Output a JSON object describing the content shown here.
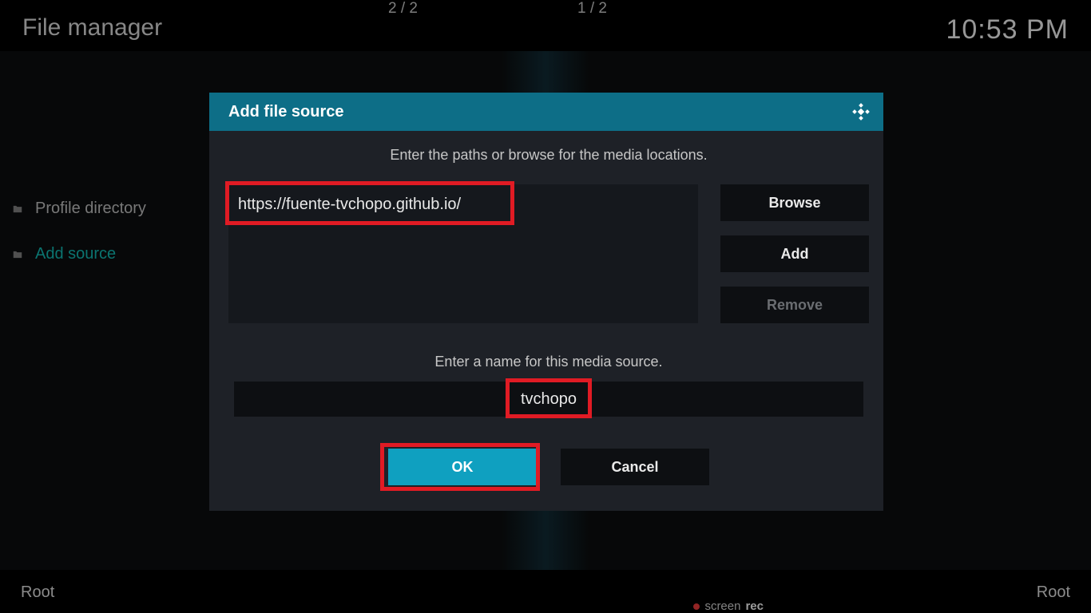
{
  "header": {
    "title": "File manager",
    "time": "10:53 PM"
  },
  "sidebar": {
    "items": [
      {
        "label": "Profile directory",
        "active": false
      },
      {
        "label": "Add source",
        "active": true
      }
    ]
  },
  "dialog": {
    "title": "Add file source",
    "paths_hint": "Enter the paths or browse for the media locations.",
    "path_value": "https://fuente-tvchopo.github.io/",
    "browse_label": "Browse",
    "add_label": "Add",
    "remove_label": "Remove",
    "name_hint": "Enter a name for this media source.",
    "name_value": "tvchopo",
    "ok_label": "OK",
    "cancel_label": "Cancel"
  },
  "bottom": {
    "left_root": "Root",
    "right_root": "Root",
    "counter_left": "2 / 2",
    "counter_right": "1 / 2"
  },
  "screenrec": {
    "brand": "screen",
    "suffix": "rec"
  },
  "colors": {
    "accent": "#0fa0c0",
    "teal_text": "#12b2ac",
    "dialog_header": "#0d6e87"
  }
}
